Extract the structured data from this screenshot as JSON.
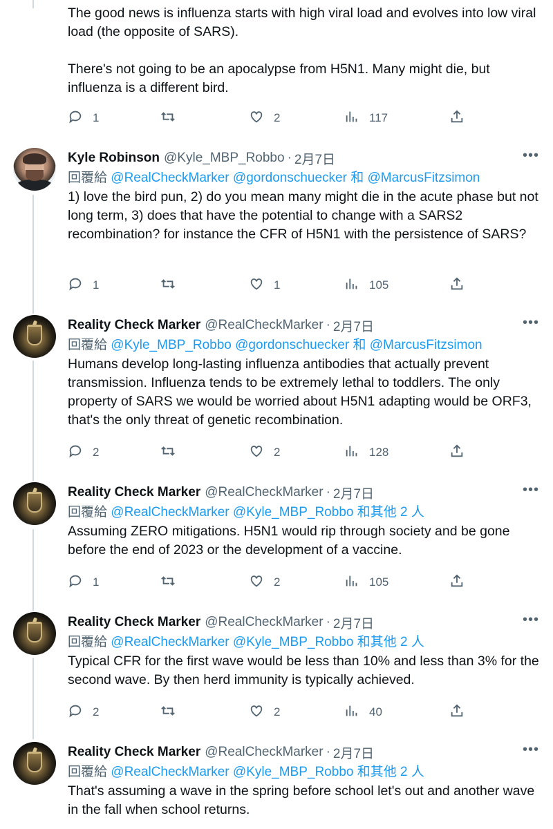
{
  "top_tweet": {
    "body": "The good news is influenza starts with high viral load and evolves into low viral load (the opposite of SARS).\n\nThere's not going to be an apocalypse from H5N1. Many might die, but influenza is a different bird.",
    "replies": "1",
    "retweets": "",
    "likes": "2",
    "views": "117"
  },
  "tweets": [
    {
      "name": "Kyle Robinson",
      "handle": "@Kyle_MBP_Robbo",
      "date": "2月7日",
      "replying_prefix": "回覆給",
      "replying_links": "@RealCheckMarker @gordonschuecker 和 @MarcusFitzsimon",
      "body": "1) love the bird pun, 2) do you mean many might die in the acute phase but not long term, 3) does that have the potential to change with a SARS2 recombination? for instance the CFR of H5N1 with the persistence of SARS?",
      "replies": "1",
      "likes": "1",
      "views": "105"
    },
    {
      "name": "Reality Check Marker",
      "handle": "@RealCheckMarker",
      "date": "2月7日",
      "replying_prefix": "回覆給",
      "replying_links": "@Kyle_MBP_Robbo @gordonschuecker 和 @MarcusFitzsimon",
      "body": "Humans develop long-lasting influenza antibodies that actually prevent transmission. Influenza tends to be extremely lethal to toddlers. The only property of SARS we would be worried about H5N1 adapting would be ORF3, that's the only threat of genetic recombination.",
      "replies": "2",
      "likes": "2",
      "views": "128"
    },
    {
      "name": "Reality Check Marker",
      "handle": "@RealCheckMarker",
      "date": "2月7日",
      "replying_prefix": "回覆給",
      "replying_links": "@RealCheckMarker @Kyle_MBP_Robbo 和其他 2 人",
      "body": "Assuming ZERO mitigations. H5N1 would rip through society and be gone before the end of 2023 or the development of a vaccine.",
      "replies": "1",
      "likes": "2",
      "views": "105"
    },
    {
      "name": "Reality Check Marker",
      "handle": "@RealCheckMarker",
      "date": "2月7日",
      "replying_prefix": "回覆給",
      "replying_links": "@RealCheckMarker @Kyle_MBP_Robbo 和其他 2 人",
      "body": "Typical CFR for the first wave would be less than 10% and less than 3% for the second wave. By then herd immunity is typically achieved.",
      "replies": "2",
      "likes": "2",
      "views": "40"
    },
    {
      "name": "Reality Check Marker",
      "handle": "@RealCheckMarker",
      "date": "2月7日",
      "replying_prefix": "回覆給",
      "replying_links": "@RealCheckMarker @Kyle_MBP_Robbo 和其他 2 人",
      "body": "That's assuming a wave in the spring before school let's out and another wave in the fall when school returns."
    }
  ],
  "separator": "·",
  "more_glyph": "•••",
  "colors": {
    "link": "#1d9bf0",
    "secondary": "#536471",
    "text": "#0f1419",
    "thread_line": "#cfd9de"
  },
  "icons": [
    "reply-icon",
    "retweet-icon",
    "like-icon",
    "views-icon",
    "share-icon",
    "more-icon"
  ]
}
